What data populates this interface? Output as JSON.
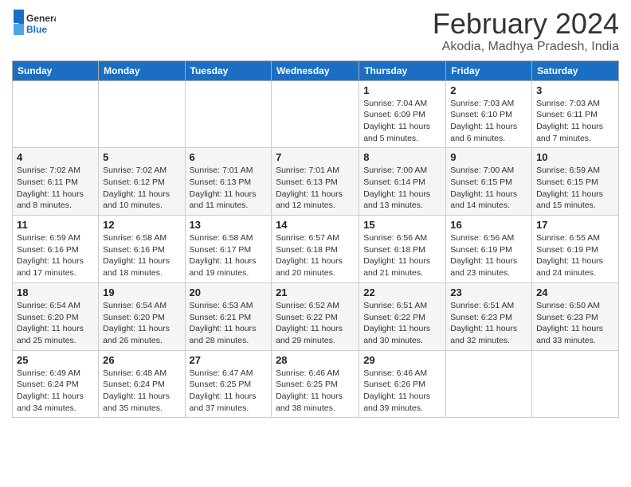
{
  "logo": {
    "general": "General",
    "blue": "Blue"
  },
  "title": "February 2024",
  "location": "Akodia, Madhya Pradesh, India",
  "days_of_week": [
    "Sunday",
    "Monday",
    "Tuesday",
    "Wednesday",
    "Thursday",
    "Friday",
    "Saturday"
  ],
  "weeks": [
    [
      {
        "day": "",
        "info": ""
      },
      {
        "day": "",
        "info": ""
      },
      {
        "day": "",
        "info": ""
      },
      {
        "day": "",
        "info": ""
      },
      {
        "day": "1",
        "info": "Sunrise: 7:04 AM\nSunset: 6:09 PM\nDaylight: 11 hours\nand 5 minutes."
      },
      {
        "day": "2",
        "info": "Sunrise: 7:03 AM\nSunset: 6:10 PM\nDaylight: 11 hours\nand 6 minutes."
      },
      {
        "day": "3",
        "info": "Sunrise: 7:03 AM\nSunset: 6:11 PM\nDaylight: 11 hours\nand 7 minutes."
      }
    ],
    [
      {
        "day": "4",
        "info": "Sunrise: 7:02 AM\nSunset: 6:11 PM\nDaylight: 11 hours\nand 8 minutes."
      },
      {
        "day": "5",
        "info": "Sunrise: 7:02 AM\nSunset: 6:12 PM\nDaylight: 11 hours\nand 10 minutes."
      },
      {
        "day": "6",
        "info": "Sunrise: 7:01 AM\nSunset: 6:13 PM\nDaylight: 11 hours\nand 11 minutes."
      },
      {
        "day": "7",
        "info": "Sunrise: 7:01 AM\nSunset: 6:13 PM\nDaylight: 11 hours\nand 12 minutes."
      },
      {
        "day": "8",
        "info": "Sunrise: 7:00 AM\nSunset: 6:14 PM\nDaylight: 11 hours\nand 13 minutes."
      },
      {
        "day": "9",
        "info": "Sunrise: 7:00 AM\nSunset: 6:15 PM\nDaylight: 11 hours\nand 14 minutes."
      },
      {
        "day": "10",
        "info": "Sunrise: 6:59 AM\nSunset: 6:15 PM\nDaylight: 11 hours\nand 15 minutes."
      }
    ],
    [
      {
        "day": "11",
        "info": "Sunrise: 6:59 AM\nSunset: 6:16 PM\nDaylight: 11 hours\nand 17 minutes."
      },
      {
        "day": "12",
        "info": "Sunrise: 6:58 AM\nSunset: 6:16 PM\nDaylight: 11 hours\nand 18 minutes."
      },
      {
        "day": "13",
        "info": "Sunrise: 6:58 AM\nSunset: 6:17 PM\nDaylight: 11 hours\nand 19 minutes."
      },
      {
        "day": "14",
        "info": "Sunrise: 6:57 AM\nSunset: 6:18 PM\nDaylight: 11 hours\nand 20 minutes."
      },
      {
        "day": "15",
        "info": "Sunrise: 6:56 AM\nSunset: 6:18 PM\nDaylight: 11 hours\nand 21 minutes."
      },
      {
        "day": "16",
        "info": "Sunrise: 6:56 AM\nSunset: 6:19 PM\nDaylight: 11 hours\nand 23 minutes."
      },
      {
        "day": "17",
        "info": "Sunrise: 6:55 AM\nSunset: 6:19 PM\nDaylight: 11 hours\nand 24 minutes."
      }
    ],
    [
      {
        "day": "18",
        "info": "Sunrise: 6:54 AM\nSunset: 6:20 PM\nDaylight: 11 hours\nand 25 minutes."
      },
      {
        "day": "19",
        "info": "Sunrise: 6:54 AM\nSunset: 6:20 PM\nDaylight: 11 hours\nand 26 minutes."
      },
      {
        "day": "20",
        "info": "Sunrise: 6:53 AM\nSunset: 6:21 PM\nDaylight: 11 hours\nand 28 minutes."
      },
      {
        "day": "21",
        "info": "Sunrise: 6:52 AM\nSunset: 6:22 PM\nDaylight: 11 hours\nand 29 minutes."
      },
      {
        "day": "22",
        "info": "Sunrise: 6:51 AM\nSunset: 6:22 PM\nDaylight: 11 hours\nand 30 minutes."
      },
      {
        "day": "23",
        "info": "Sunrise: 6:51 AM\nSunset: 6:23 PM\nDaylight: 11 hours\nand 32 minutes."
      },
      {
        "day": "24",
        "info": "Sunrise: 6:50 AM\nSunset: 6:23 PM\nDaylight: 11 hours\nand 33 minutes."
      }
    ],
    [
      {
        "day": "25",
        "info": "Sunrise: 6:49 AM\nSunset: 6:24 PM\nDaylight: 11 hours\nand 34 minutes."
      },
      {
        "day": "26",
        "info": "Sunrise: 6:48 AM\nSunset: 6:24 PM\nDaylight: 11 hours\nand 35 minutes."
      },
      {
        "day": "27",
        "info": "Sunrise: 6:47 AM\nSunset: 6:25 PM\nDaylight: 11 hours\nand 37 minutes."
      },
      {
        "day": "28",
        "info": "Sunrise: 6:46 AM\nSunset: 6:25 PM\nDaylight: 11 hours\nand 38 minutes."
      },
      {
        "day": "29",
        "info": "Sunrise: 6:46 AM\nSunset: 6:26 PM\nDaylight: 11 hours\nand 39 minutes."
      },
      {
        "day": "",
        "info": ""
      },
      {
        "day": "",
        "info": ""
      }
    ]
  ]
}
